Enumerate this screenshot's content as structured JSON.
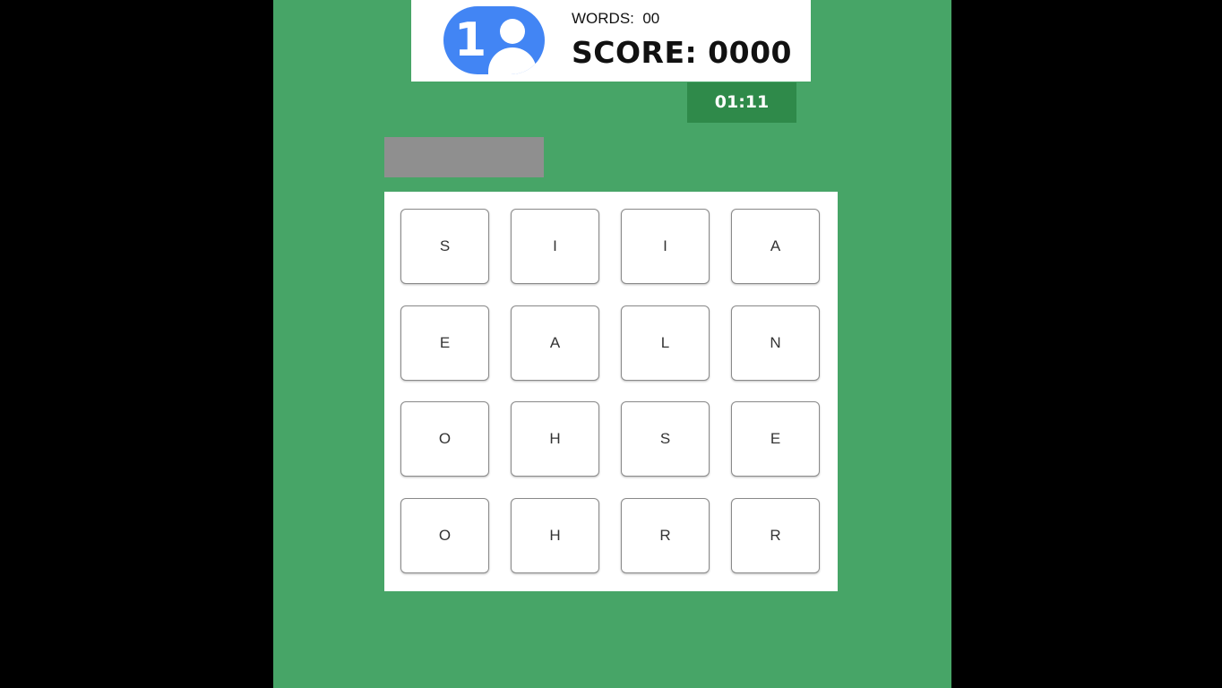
{
  "header": {
    "avatar_number": "1",
    "words_label": "WORDS:  00",
    "score_label": "SCORE: 0000"
  },
  "timer": "01:11",
  "current_word": "",
  "board": {
    "tiles": [
      "S",
      "I",
      "I",
      "A",
      "E",
      "A",
      "L",
      "N",
      "O",
      "H",
      "S",
      "E",
      "O",
      "H",
      "R",
      "R"
    ]
  },
  "colors": {
    "background": "#47a567",
    "timer": "#2f8a4a",
    "avatar": "#4285f4",
    "current_word_box": "#8f8f8f"
  },
  "icons": {
    "avatar": "player-avatar-icon"
  }
}
